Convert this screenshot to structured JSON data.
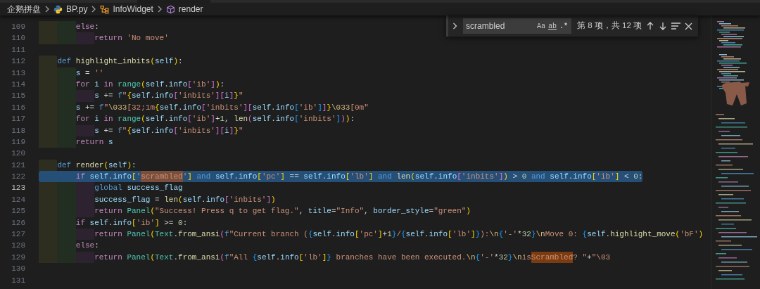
{
  "tab_strip": {
    "kind": "strip"
  },
  "breadcrumbs": [
    {
      "label": "企鹅拼盘",
      "kind": "folder"
    },
    {
      "label": "BP.py",
      "kind": "python-file"
    },
    {
      "label": "InfoWidget",
      "kind": "class"
    },
    {
      "label": "render",
      "kind": "method"
    }
  ],
  "find_widget": {
    "query": "scrambled",
    "count": "第 8 项，共 12 项",
    "options": [
      {
        "label": "Aa",
        "kind": "case",
        "on": false
      },
      {
        "label": "ab",
        "kind": "word",
        "on": false
      },
      {
        "label": ".*",
        "kind": "regex",
        "on": false
      }
    ]
  },
  "lines": [
    {
      "number": "109",
      "selected": false,
      "cursor": false,
      "tokens": [
        {
          "text": "        else",
          "kind": "kw"
        },
        {
          "text": ":",
          "kind": "op"
        }
      ]
    },
    {
      "number": "110",
      "selected": false,
      "cursor": false,
      "tokens": [
        {
          "text": "            return ",
          "kind": "kw"
        },
        {
          "text": "'No move'",
          "kind": "str"
        }
      ]
    },
    {
      "number": "111",
      "selected": false,
      "cursor": false
    },
    {
      "number": "112",
      "selected": false,
      "cursor": false,
      "tokens": [
        {
          "text": "    def ",
          "kind": "def"
        },
        {
          "text": "highlight_inbits",
          "kind": "fn"
        },
        {
          "text": "(",
          "kind": "b1"
        },
        {
          "text": "self",
          "kind": "var"
        },
        {
          "text": ")",
          "kind": "b1"
        },
        {
          "text": ":",
          "kind": "op"
        }
      ]
    },
    {
      "number": "113",
      "selected": false,
      "cursor": false,
      "tokens": [
        {
          "text": "        s",
          "kind": "var"
        },
        {
          "text": " = ",
          "kind": "op"
        },
        {
          "text": "''",
          "kind": "str"
        }
      ]
    },
    {
      "number": "114",
      "selected": false,
      "cursor": false,
      "tokens": [
        {
          "text": "        for ",
          "kind": "kw"
        },
        {
          "text": "i ",
          "kind": "var"
        },
        {
          "text": "in ",
          "kind": "kw"
        },
        {
          "text": "range",
          "kind": "cls"
        },
        {
          "text": "(",
          "kind": "b1"
        },
        {
          "text": "self",
          "kind": "var"
        },
        {
          "text": ".",
          "kind": "op"
        },
        {
          "text": "info",
          "kind": "var"
        },
        {
          "text": "[",
          "kind": "b2"
        },
        {
          "text": "'ib'",
          "kind": "str"
        },
        {
          "text": "]",
          "kind": "b2"
        },
        {
          "text": ")",
          "kind": "b1"
        },
        {
          "text": ":",
          "kind": "op"
        }
      ]
    },
    {
      "number": "115",
      "selected": false,
      "cursor": false,
      "tokens": [
        {
          "text": "            s",
          "kind": "var"
        },
        {
          "text": " += ",
          "kind": "op"
        },
        {
          "text": "f",
          "kind": "def"
        },
        {
          "text": "\"",
          "kind": "str"
        },
        {
          "text": "{",
          "kind": "b1"
        },
        {
          "text": "self",
          "kind": "var"
        },
        {
          "text": ".",
          "kind": "op"
        },
        {
          "text": "info",
          "kind": "var"
        },
        {
          "text": "[",
          "kind": "b2"
        },
        {
          "text": "'inbits'",
          "kind": "str"
        },
        {
          "text": "]",
          "kind": "b2"
        },
        {
          "text": "[",
          "kind": "b2"
        },
        {
          "text": "i",
          "kind": "var"
        },
        {
          "text": "]",
          "kind": "b2"
        },
        {
          "text": "}",
          "kind": "b1"
        },
        {
          "text": "\"",
          "kind": "str"
        }
      ]
    },
    {
      "number": "116",
      "selected": false,
      "cursor": false,
      "tokens": [
        {
          "text": "        s",
          "kind": "var"
        },
        {
          "text": " += ",
          "kind": "op"
        },
        {
          "text": "f",
          "kind": "def"
        },
        {
          "text": "\"",
          "kind": "str"
        },
        {
          "text": "\\033",
          "kind": "esc"
        },
        {
          "text": "[32;1m",
          "kind": "str"
        },
        {
          "text": "{",
          "kind": "b1"
        },
        {
          "text": "self",
          "kind": "var"
        },
        {
          "text": ".",
          "kind": "op"
        },
        {
          "text": "info",
          "kind": "var"
        },
        {
          "text": "[",
          "kind": "b2"
        },
        {
          "text": "'inbits'",
          "kind": "str"
        },
        {
          "text": "]",
          "kind": "b2"
        },
        {
          "text": "[",
          "kind": "b2"
        },
        {
          "text": "self",
          "kind": "var"
        },
        {
          "text": ".",
          "kind": "op"
        },
        {
          "text": "info",
          "kind": "var"
        },
        {
          "text": "[",
          "kind": "b3"
        },
        {
          "text": "'ib'",
          "kind": "str"
        },
        {
          "text": "]",
          "kind": "b3"
        },
        {
          "text": "]",
          "kind": "b2"
        },
        {
          "text": "}",
          "kind": "b1"
        },
        {
          "text": "\\033",
          "kind": "esc"
        },
        {
          "text": "[0m\"",
          "kind": "str"
        }
      ]
    },
    {
      "number": "117",
      "selected": false,
      "cursor": false,
      "tokens": [
        {
          "text": "        for ",
          "kind": "kw"
        },
        {
          "text": "i ",
          "kind": "var"
        },
        {
          "text": "in ",
          "kind": "kw"
        },
        {
          "text": "range",
          "kind": "cls"
        },
        {
          "text": "(",
          "kind": "b1"
        },
        {
          "text": "self",
          "kind": "var"
        },
        {
          "text": ".",
          "kind": "op"
        },
        {
          "text": "info",
          "kind": "var"
        },
        {
          "text": "[",
          "kind": "b2"
        },
        {
          "text": "'ib'",
          "kind": "str"
        },
        {
          "text": "]",
          "kind": "b2"
        },
        {
          "text": "+",
          "kind": "op"
        },
        {
          "text": "1",
          "kind": "num"
        },
        {
          "text": ", ",
          "kind": "op"
        },
        {
          "text": "len",
          "kind": "fn"
        },
        {
          "text": "(",
          "kind": "b2"
        },
        {
          "text": "self",
          "kind": "var"
        },
        {
          "text": ".",
          "kind": "op"
        },
        {
          "text": "info",
          "kind": "var"
        },
        {
          "text": "[",
          "kind": "b3"
        },
        {
          "text": "'inbits'",
          "kind": "str"
        },
        {
          "text": "]",
          "kind": "b3"
        },
        {
          "text": ")",
          "kind": "b2"
        },
        {
          "text": ")",
          "kind": "b1"
        },
        {
          "text": ":",
          "kind": "op"
        }
      ]
    },
    {
      "number": "118",
      "selected": false,
      "cursor": false,
      "tokens": [
        {
          "text": "            s",
          "kind": "var"
        },
        {
          "text": " += ",
          "kind": "op"
        },
        {
          "text": "f",
          "kind": "def"
        },
        {
          "text": "\"",
          "kind": "str"
        },
        {
          "text": "{",
          "kind": "b1"
        },
        {
          "text": "self",
          "kind": "var"
        },
        {
          "text": ".",
          "kind": "op"
        },
        {
          "text": "info",
          "kind": "var"
        },
        {
          "text": "[",
          "kind": "b2"
        },
        {
          "text": "'inbits'",
          "kind": "str"
        },
        {
          "text": "]",
          "kind": "b2"
        },
        {
          "text": "[",
          "kind": "b2"
        },
        {
          "text": "i",
          "kind": "var"
        },
        {
          "text": "]",
          "kind": "b2"
        },
        {
          "text": "}",
          "kind": "b1"
        },
        {
          "text": "\"",
          "kind": "str"
        }
      ]
    },
    {
      "number": "119",
      "selected": false,
      "cursor": false,
      "tokens": [
        {
          "text": "        return",
          "kind": "kw"
        },
        {
          "text": " s",
          "kind": "var"
        }
      ]
    },
    {
      "number": "120",
      "selected": false,
      "cursor": false
    },
    {
      "number": "121",
      "selected": false,
      "cursor": false,
      "tokens": [
        {
          "text": "    def ",
          "kind": "def"
        },
        {
          "text": "render",
          "kind": "fn"
        },
        {
          "text": "(",
          "kind": "b1"
        },
        {
          "text": "self",
          "kind": "var"
        },
        {
          "text": ")",
          "kind": "b1"
        },
        {
          "text": ":",
          "kind": "op"
        }
      ]
    },
    {
      "number": "122",
      "selected": true,
      "cursor": false,
      "tokens": [
        {
          "text": "        if ",
          "kind": "kw"
        },
        {
          "text": "self",
          "kind": "var"
        },
        {
          "text": ".",
          "kind": "op"
        },
        {
          "text": "info",
          "kind": "var"
        },
        {
          "text": "[",
          "kind": "b1"
        },
        {
          "text": "'",
          "kind": "str"
        },
        {
          "text": "scrambled",
          "kind": "match"
        },
        {
          "text": "'",
          "kind": "str"
        },
        {
          "text": "]",
          "kind": "b1"
        },
        {
          "text": " and ",
          "kind": "def"
        },
        {
          "text": "self",
          "kind": "var"
        },
        {
          "text": ".",
          "kind": "op"
        },
        {
          "text": "info",
          "kind": "var"
        },
        {
          "text": "[",
          "kind": "b1"
        },
        {
          "text": "'pc'",
          "kind": "str"
        },
        {
          "text": "]",
          "kind": "b1"
        },
        {
          "text": " == ",
          "kind": "op"
        },
        {
          "text": "self",
          "kind": "var"
        },
        {
          "text": ".",
          "kind": "op"
        },
        {
          "text": "info",
          "kind": "var"
        },
        {
          "text": "[",
          "kind": "b1"
        },
        {
          "text": "'lb'",
          "kind": "str"
        },
        {
          "text": "]",
          "kind": "b1"
        },
        {
          "text": " and ",
          "kind": "def"
        },
        {
          "text": "len",
          "kind": "fn"
        },
        {
          "text": "(",
          "kind": "b1"
        },
        {
          "text": "self",
          "kind": "var"
        },
        {
          "text": ".",
          "kind": "op"
        },
        {
          "text": "info",
          "kind": "var"
        },
        {
          "text": "[",
          "kind": "b2"
        },
        {
          "text": "'inbits'",
          "kind": "str"
        },
        {
          "text": "]",
          "kind": "b2"
        },
        {
          "text": ")",
          "kind": "b1"
        },
        {
          "text": " > ",
          "kind": "op"
        },
        {
          "text": "0",
          "kind": "num"
        },
        {
          "text": " and ",
          "kind": "def"
        },
        {
          "text": "self",
          "kind": "var"
        },
        {
          "text": ".",
          "kind": "op"
        },
        {
          "text": "info",
          "kind": "var"
        },
        {
          "text": "[",
          "kind": "b1"
        },
        {
          "text": "'ib'",
          "kind": "str"
        },
        {
          "text": "]",
          "kind": "b1"
        },
        {
          "text": " < ",
          "kind": "op"
        },
        {
          "text": "0",
          "kind": "num"
        },
        {
          "text": ":",
          "kind": "op"
        }
      ]
    },
    {
      "number": "123",
      "selected": false,
      "cursor": true,
      "tokens": [
        {
          "text": "            global",
          "kind": "def"
        },
        {
          "text": " success_flag",
          "kind": "var"
        }
      ]
    },
    {
      "number": "124",
      "selected": false,
      "cursor": false,
      "tokens": [
        {
          "text": "            success_flag",
          "kind": "var"
        },
        {
          "text": " = ",
          "kind": "op"
        },
        {
          "text": "len",
          "kind": "fn"
        },
        {
          "text": "(",
          "kind": "b1"
        },
        {
          "text": "self",
          "kind": "var"
        },
        {
          "text": ".",
          "kind": "op"
        },
        {
          "text": "info",
          "kind": "var"
        },
        {
          "text": "[",
          "kind": "b2"
        },
        {
          "text": "'inbits'",
          "kind": "str"
        },
        {
          "text": "]",
          "kind": "b2"
        },
        {
          "text": ")",
          "kind": "b1"
        }
      ]
    },
    {
      "number": "125",
      "selected": false,
      "cursor": false,
      "tokens": [
        {
          "text": "            return ",
          "kind": "kw"
        },
        {
          "text": "Panel",
          "kind": "cls"
        },
        {
          "text": "(",
          "kind": "b1"
        },
        {
          "text": "\"Success! Press q to get flag.\"",
          "kind": "str"
        },
        {
          "text": ", ",
          "kind": "op"
        },
        {
          "text": "title",
          "kind": "var"
        },
        {
          "text": "=",
          "kind": "op"
        },
        {
          "text": "\"Info\"",
          "kind": "str"
        },
        {
          "text": ", ",
          "kind": "op"
        },
        {
          "text": "border_style",
          "kind": "var"
        },
        {
          "text": "=",
          "kind": "op"
        },
        {
          "text": "\"green\"",
          "kind": "str"
        },
        {
          "text": ")",
          "kind": "b1"
        }
      ]
    },
    {
      "number": "126",
      "selected": false,
      "cursor": false,
      "tokens": [
        {
          "text": "        if ",
          "kind": "kw"
        },
        {
          "text": "self",
          "kind": "var"
        },
        {
          "text": ".",
          "kind": "op"
        },
        {
          "text": "info",
          "kind": "var"
        },
        {
          "text": "[",
          "kind": "b1"
        },
        {
          "text": "'ib'",
          "kind": "str"
        },
        {
          "text": "]",
          "kind": "b1"
        },
        {
          "text": " >= ",
          "kind": "op"
        },
        {
          "text": "0",
          "kind": "num"
        },
        {
          "text": ":",
          "kind": "op"
        }
      ]
    },
    {
      "number": "127",
      "selected": false,
      "cursor": false,
      "tokens": [
        {
          "text": "            return ",
          "kind": "kw"
        },
        {
          "text": "Panel",
          "kind": "cls"
        },
        {
          "text": "(",
          "kind": "b1"
        },
        {
          "text": "Text",
          "kind": "cls"
        },
        {
          "text": ".",
          "kind": "op"
        },
        {
          "text": "from_ansi",
          "kind": "fn"
        },
        {
          "text": "(",
          "kind": "b2"
        },
        {
          "text": "f",
          "kind": "def"
        },
        {
          "text": "\"Current branch (",
          "kind": "str"
        },
        {
          "text": "{",
          "kind": "b3"
        },
        {
          "text": "self",
          "kind": "var"
        },
        {
          "text": ".",
          "kind": "op"
        },
        {
          "text": "info",
          "kind": "var"
        },
        {
          "text": "[",
          "kind": "b1"
        },
        {
          "text": "'pc'",
          "kind": "str"
        },
        {
          "text": "]",
          "kind": "b1"
        },
        {
          "text": "+",
          "kind": "op"
        },
        {
          "text": "1",
          "kind": "num"
        },
        {
          "text": "}",
          "kind": "b3"
        },
        {
          "text": "/",
          "kind": "str"
        },
        {
          "text": "{",
          "kind": "b3"
        },
        {
          "text": "self",
          "kind": "var"
        },
        {
          "text": ".",
          "kind": "op"
        },
        {
          "text": "info",
          "kind": "var"
        },
        {
          "text": "[",
          "kind": "b1"
        },
        {
          "text": "'lb'",
          "kind": "str"
        },
        {
          "text": "]",
          "kind": "b1"
        },
        {
          "text": "}",
          "kind": "b3"
        },
        {
          "text": "):",
          "kind": "str"
        },
        {
          "text": "\\n",
          "kind": "esc"
        },
        {
          "text": "{",
          "kind": "b3"
        },
        {
          "text": "'-'",
          "kind": "str"
        },
        {
          "text": "*",
          "kind": "op"
        },
        {
          "text": "32",
          "kind": "num"
        },
        {
          "text": "}",
          "kind": "b3"
        },
        {
          "text": "\\n",
          "kind": "esc"
        },
        {
          "text": "Move 0: ",
          "kind": "str"
        },
        {
          "text": "{",
          "kind": "b3"
        },
        {
          "text": "self",
          "kind": "var"
        },
        {
          "text": ".",
          "kind": "op"
        },
        {
          "text": "highlight_move",
          "kind": "fn"
        },
        {
          "text": "(",
          "kind": "b1"
        },
        {
          "text": "'bF'",
          "kind": "str"
        },
        {
          "text": ")",
          "kind": "b1"
        }
      ]
    },
    {
      "number": "128",
      "selected": false,
      "cursor": false,
      "tokens": [
        {
          "text": "        else",
          "kind": "kw"
        },
        {
          "text": ":",
          "kind": "op"
        }
      ]
    },
    {
      "number": "129",
      "selected": false,
      "cursor": false,
      "tokens": [
        {
          "text": "            return ",
          "kind": "kw"
        },
        {
          "text": "Panel",
          "kind": "cls"
        },
        {
          "text": "(",
          "kind": "b1"
        },
        {
          "text": "Text",
          "kind": "cls"
        },
        {
          "text": ".",
          "kind": "op"
        },
        {
          "text": "from_ansi",
          "kind": "fn"
        },
        {
          "text": "(",
          "kind": "b2"
        },
        {
          "text": "f",
          "kind": "def"
        },
        {
          "text": "\"All ",
          "kind": "str"
        },
        {
          "text": "{",
          "kind": "b3"
        },
        {
          "text": "self",
          "kind": "var"
        },
        {
          "text": ".",
          "kind": "op"
        },
        {
          "text": "info",
          "kind": "var"
        },
        {
          "text": "[",
          "kind": "b1"
        },
        {
          "text": "'lb'",
          "kind": "str"
        },
        {
          "text": "]",
          "kind": "b1"
        },
        {
          "text": "}",
          "kind": "b3"
        },
        {
          "text": " branches have been executed.",
          "kind": "str"
        },
        {
          "text": "\\n",
          "kind": "esc"
        },
        {
          "text": "{",
          "kind": "b3"
        },
        {
          "text": "'-'",
          "kind": "str"
        },
        {
          "text": "*",
          "kind": "op"
        },
        {
          "text": "32",
          "kind": "num"
        },
        {
          "text": "}",
          "kind": "b3"
        },
        {
          "text": "\\n",
          "kind": "esc"
        },
        {
          "text": "is",
          "kind": "str"
        },
        {
          "text": "Scrambled",
          "kind": "current-match"
        },
        {
          "text": "? \"",
          "kind": "str"
        },
        {
          "text": "+",
          "kind": "op"
        },
        {
          "text": "\"\\03",
          "kind": "str"
        }
      ]
    },
    {
      "number": "130",
      "selected": false,
      "cursor": false
    },
    {
      "number": "131",
      "selected": false,
      "cursor": false
    }
  ]
}
